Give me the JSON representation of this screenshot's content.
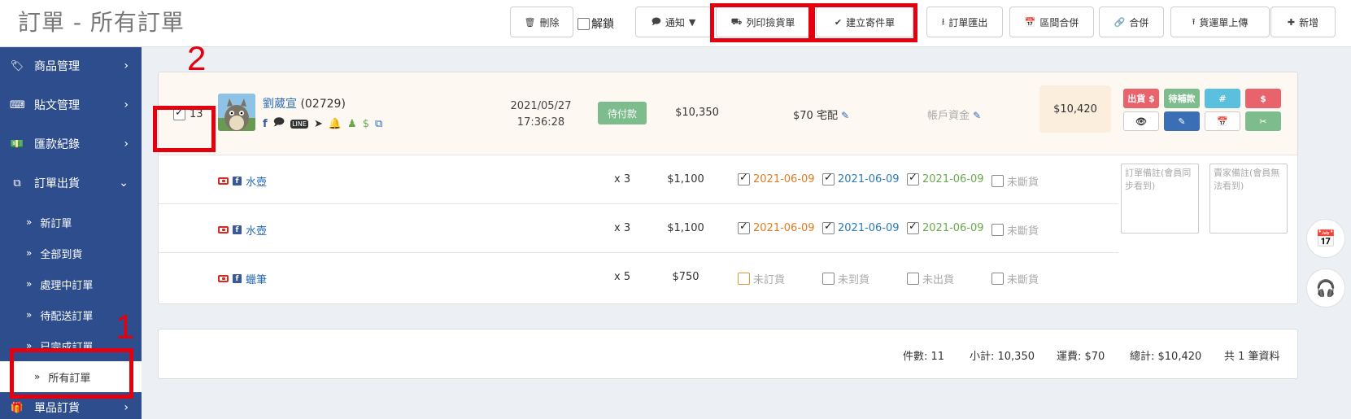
{
  "header": {
    "title": "訂單 - 所有訂單",
    "delete_label": "刪除",
    "unlock_label": "解鎖",
    "notify_label": "通知",
    "print_pick_label": "列印撿貨單",
    "create_ship_label": "建立寄件單",
    "export_label": "訂單匯出",
    "range_merge_label": "區間合併",
    "merge_label": "合併",
    "upload_label": "貨運單上傳",
    "new_label": "新增"
  },
  "sidebar": {
    "items": [
      {
        "label": "商品管理",
        "icon": "tag-icon"
      },
      {
        "label": "貼文管理",
        "icon": "keyboard-icon"
      },
      {
        "label": "匯款紀錄",
        "icon": "money-icon"
      },
      {
        "label": "訂單出貨",
        "icon": "clone-icon"
      }
    ],
    "sub_items": [
      "新訂單",
      "全部到貨",
      "處理中訂單",
      "待配送訂單",
      "已完成訂單",
      "所有訂單"
    ],
    "bottom_item": {
      "label": "單品訂貨",
      "icon": "gift-icon"
    }
  },
  "order": {
    "select_count": "13",
    "buyer_name": "劉葳宣",
    "buyer_id": "(02729)",
    "date": "2021/05/27",
    "time": "17:36:28",
    "pay_status": "待付款",
    "subtotal": "$10,350",
    "shipping": "$70 宅配",
    "account": "帳戶資金",
    "total": "$10,420",
    "action_buttons": [
      "出貨 $",
      "待補款",
      "#",
      "$"
    ],
    "colors": {
      "red": "#e8636b",
      "green": "#7dbc8c",
      "cyan": "#5bc0de",
      "blue": "#3a6eb5"
    }
  },
  "items": [
    {
      "name": "水壺",
      "qty": "x 3",
      "price": "$1,100",
      "statuses": [
        {
          "label": "2021-06-09",
          "checked": true,
          "color": "#e07b22"
        },
        {
          "label": "2021-06-09",
          "checked": true,
          "color": "#2a7ab8"
        },
        {
          "label": "2021-06-09",
          "checked": true,
          "color": "#6aa84f"
        },
        {
          "label": "未斷貨",
          "checked": false,
          "color": "#aaaaaa"
        }
      ]
    },
    {
      "name": "水壺",
      "qty": "x 3",
      "price": "$1,100",
      "statuses": [
        {
          "label": "2021-06-09",
          "checked": true,
          "color": "#e07b22"
        },
        {
          "label": "2021-06-09",
          "checked": true,
          "color": "#2a7ab8"
        },
        {
          "label": "2021-06-09",
          "checked": true,
          "color": "#6aa84f"
        },
        {
          "label": "未斷貨",
          "checked": false,
          "color": "#aaaaaa"
        }
      ]
    },
    {
      "name": "蠟筆",
      "qty": "x 5",
      "price": "$750",
      "statuses": [
        {
          "label": "未訂貨",
          "checked": false,
          "color": "#aaaaaa"
        },
        {
          "label": "未到貨",
          "checked": false,
          "color": "#aaaaaa"
        },
        {
          "label": "未出貨",
          "checked": false,
          "color": "#aaaaaa"
        },
        {
          "label": "未斷貨",
          "checked": false,
          "color": "#aaaaaa"
        }
      ]
    }
  ],
  "notes": {
    "order_note_placeholder": "訂單備註(會員同步看到)",
    "seller_note_placeholder": "賣家備註(會員無法看到)"
  },
  "summary": {
    "count": "件數: 11",
    "subtotal": "小計: 10,350",
    "shipping": "運費: $70",
    "total": "總計: $10,420",
    "records": "共 1 筆資料"
  },
  "annotations": {
    "step1": "1",
    "step2": "2"
  }
}
